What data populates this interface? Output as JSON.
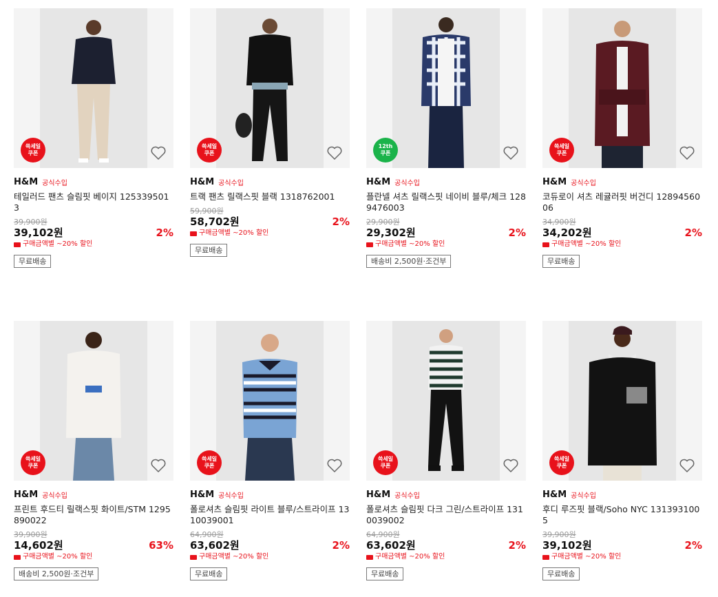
{
  "products": [
    {
      "brand": "H&M",
      "tag": "공식수입",
      "title": "테일러드 팬츠 슬림핏 베이지 1253395013",
      "original_price": "39,900원",
      "price": "39,102원",
      "discount": "2%",
      "coupon": "구매금액별 ~20% 할인",
      "shipping": "무료배송",
      "badge": [
        "쓱세일",
        "쿠폰"
      ],
      "badge_color": "#e8121b"
    },
    {
      "brand": "H&M",
      "tag": "공식수입",
      "title": "트랙 팬츠 릴랙스핏 블랙 1318762001",
      "original_price": "59,900원",
      "price": "58,702원",
      "discount": "2%",
      "coupon": "구매금액별 ~20% 할인",
      "shipping": "무료배송",
      "badge": [
        "쓱세일",
        "쿠폰"
      ],
      "badge_color": "#e8121b"
    },
    {
      "brand": "H&M",
      "tag": "공식수입",
      "title": "플란넬 셔츠 릴랙스핏 네이비 블루/체크 1289476003",
      "original_price": "29,900원",
      "price": "29,302원",
      "discount": "2%",
      "coupon": "구매금액별 ~20% 할인",
      "shipping": "배송비 2,500원·조건부",
      "badge": [
        "12th",
        "쿠폰"
      ],
      "badge_color": "#1bb34a"
    },
    {
      "brand": "H&M",
      "tag": "공식수입",
      "title": "코듀로이 셔츠 레귤러핏 버건디 1289456006",
      "original_price": "34,900원",
      "price": "34,202원",
      "discount": "2%",
      "coupon": "구매금액별 ~20% 할인",
      "shipping": "무료배송",
      "badge": [
        "쓱세일",
        "쿠폰"
      ],
      "badge_color": "#e8121b"
    },
    {
      "brand": "H&M",
      "tag": "공식수입",
      "title": "프린트 후드티 릴랙스핏 화이트/STM 1295890022",
      "original_price": "39,900원",
      "price": "14,602원",
      "discount": "63%",
      "coupon": "구매금액별 ~20% 할인",
      "shipping": "배송비 2,500원·조건부",
      "badge": [
        "쓱세일",
        "쿠폰"
      ],
      "badge_color": "#e8121b"
    },
    {
      "brand": "H&M",
      "tag": "공식수입",
      "title": "폴로셔츠 슬림핏 라이트 블루/스트라이프 1310039001",
      "original_price": "64,900원",
      "price": "63,602원",
      "discount": "2%",
      "coupon": "구매금액별 ~20% 할인",
      "shipping": "무료배송",
      "badge": [
        "쓱세일",
        "쿠폰"
      ],
      "badge_color": "#e8121b"
    },
    {
      "brand": "H&M",
      "tag": "공식수입",
      "title": "폴로셔츠 슬림핏 다크 그린/스트라이프 1310039002",
      "original_price": "64,900원",
      "price": "63,602원",
      "discount": "2%",
      "coupon": "구매금액별 ~20% 할인",
      "shipping": "무료배송",
      "badge": [
        "쓱세일",
        "쿠폰"
      ],
      "badge_color": "#e8121b"
    },
    {
      "brand": "H&M",
      "tag": "공식수입",
      "title": "후디 루즈핏 블랙/Soho NYC 1313931005",
      "original_price": "39,900원",
      "price": "39,102원",
      "discount": "2%",
      "coupon": "구매금액별 ~20% 할인",
      "shipping": "무료배송",
      "badge": [
        "쓱세일",
        "쿠폰"
      ],
      "badge_color": "#e8121b"
    }
  ]
}
